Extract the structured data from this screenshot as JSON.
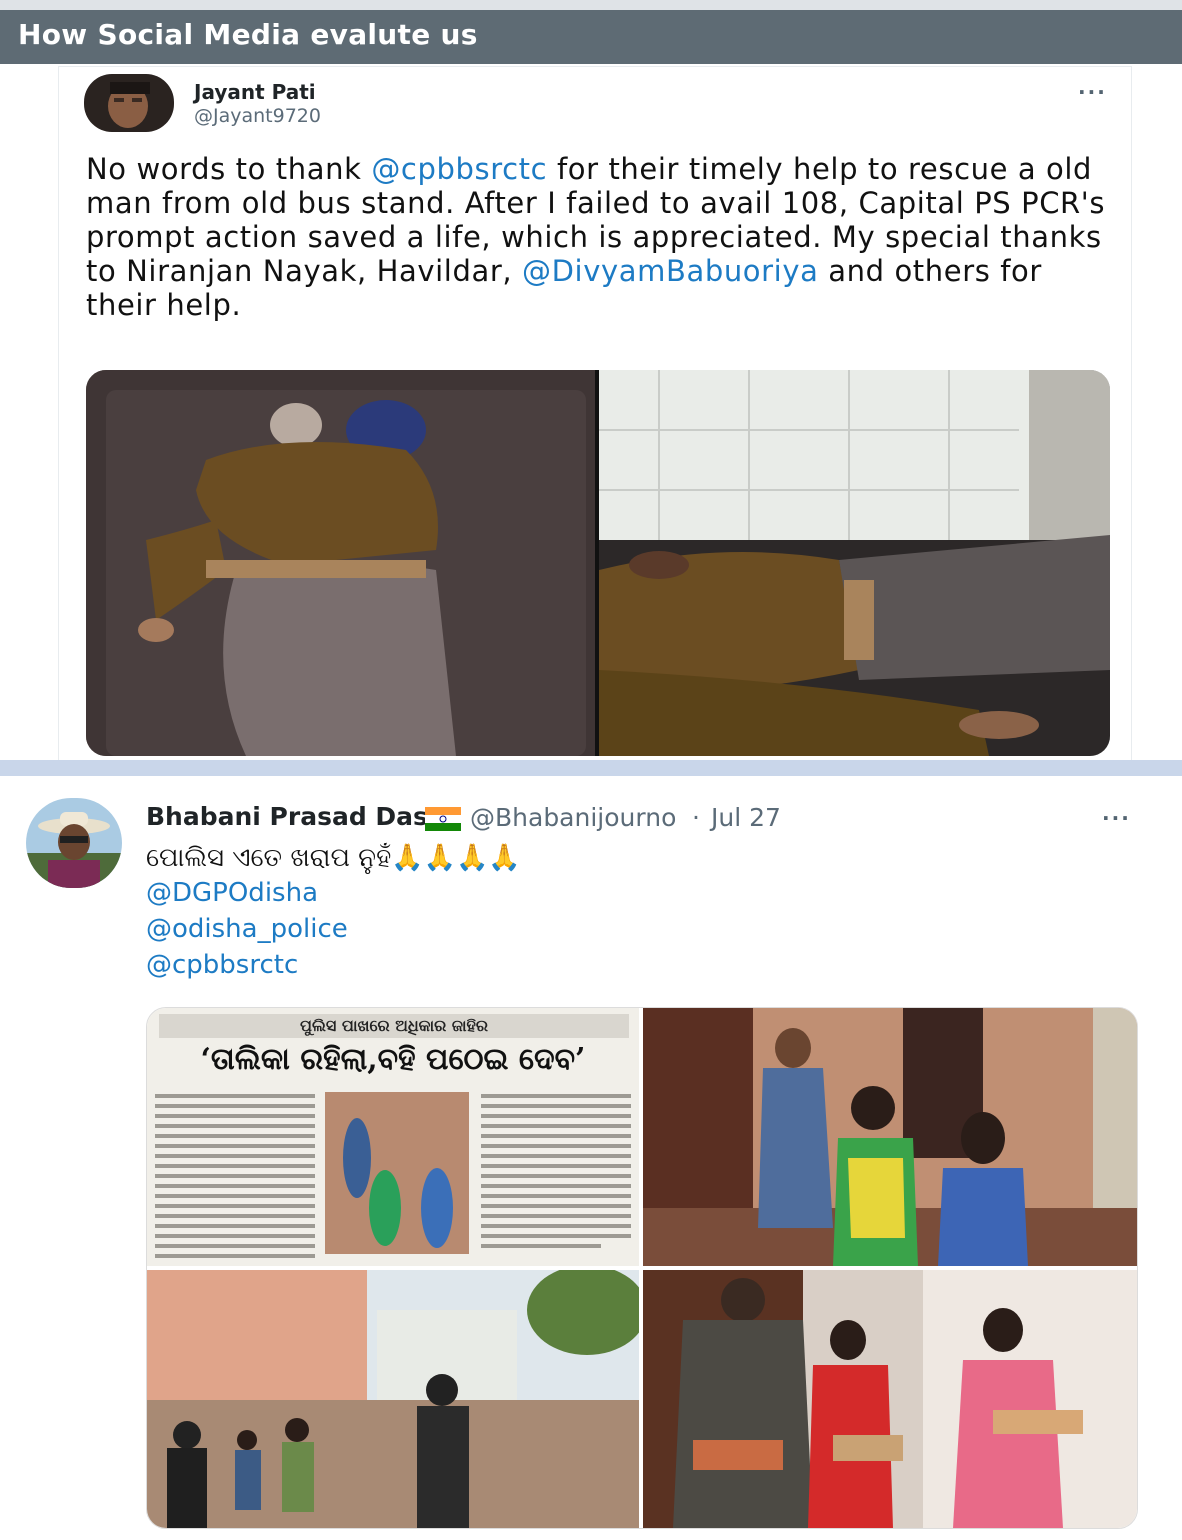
{
  "header": {
    "title": "How Social Media evalute us"
  },
  "tweet1": {
    "author_name": "Jayant Pati",
    "author_handle": "@Jayant9720",
    "more_icon": "more-horizontal-icon",
    "text": {
      "part1": "No words to thank ",
      "mention1": "@cpbbsrctc",
      "part2": " for their timely help to rescue a old man from old bus stand. After I failed to avail 108, Capital PS PCR's prompt action saved a life, which is appreciated. My special thanks to Niranjan Nayak, Havildar, ",
      "mention2": "@DivyamBabuoriya",
      "part3": " and  others for their help."
    }
  },
  "tweet2": {
    "author_name": "Bhabani Prasad Das",
    "flag_icon": "india-flag-icon",
    "author_handle": "@Bhabanijourno",
    "separator": "·",
    "date": "Jul 27",
    "more_icon": "more-horizontal-icon",
    "text_odia": "ପୋଲିସ ଏତେ ଖରାପ ନୁହଁ",
    "emoji": "🙏🙏🙏🙏",
    "mentions": [
      "@DGPOdisha",
      "@odisha_police",
      "@cpbbsrctc"
    ],
    "newspaper": {
      "kicker": "ପୁଲିସ ପାଖରେ ଅଧିକାର ଜାହିର",
      "headline": "‘ତାଲିକା ରହିଲା,ବହି ପଠେଇ ଦେବ’"
    }
  },
  "colors": {
    "header_bg": "#5e6b74",
    "mention": "#1d7bc4",
    "divider": "#c9d6ea"
  }
}
